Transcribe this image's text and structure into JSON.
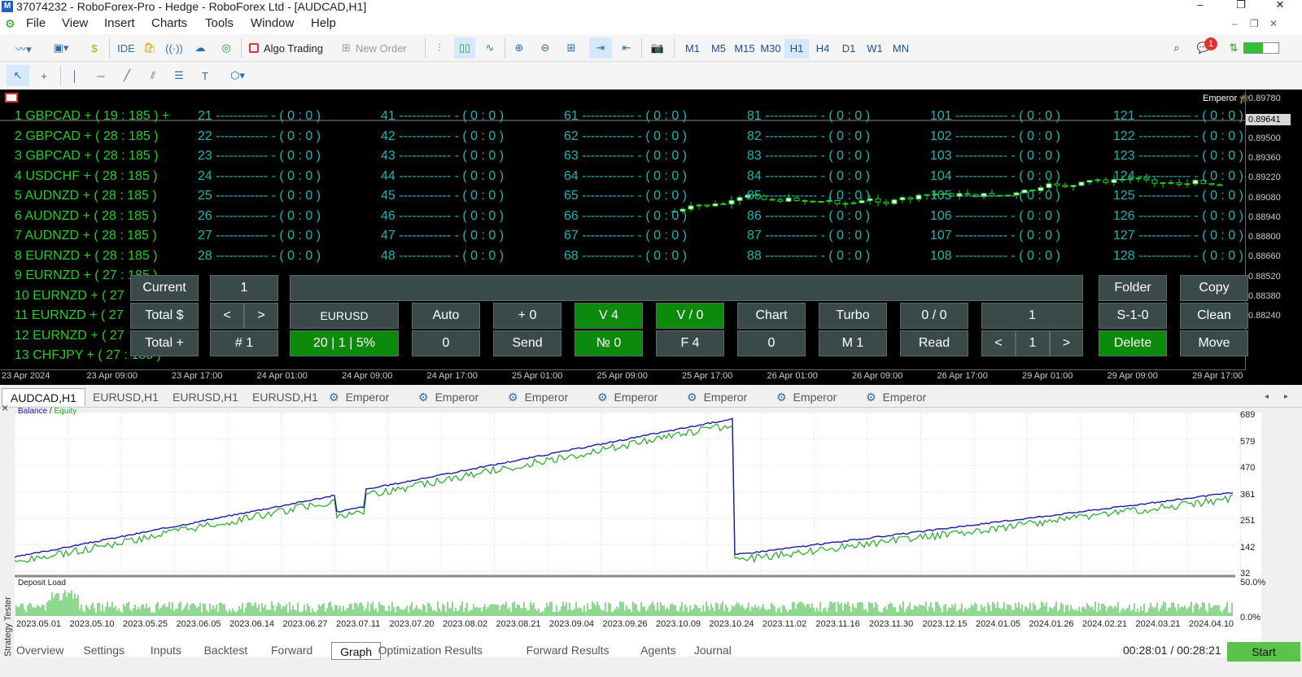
{
  "window": {
    "title": "37074232 - RoboForex-Pro - Hedge - RoboForex Ltd - [AUDCAD,H1]",
    "app_icon": "app-icon",
    "controls": [
      "–",
      "❐",
      "✕"
    ]
  },
  "menu": [
    "File",
    "View",
    "Insert",
    "Charts",
    "Tools",
    "Window",
    "Help"
  ],
  "toolbar": {
    "algo_trading": "Algo Trading",
    "new_order": "New Order",
    "ide": "IDE",
    "timeframes": [
      "M1",
      "M5",
      "M15",
      "M30",
      "H1",
      "H4",
      "D1",
      "W1",
      "MN"
    ],
    "selected_tf": "H1",
    "notifications": "1"
  },
  "chart": {
    "indicator_label": "Emperor",
    "price_current": "0.89641",
    "price_scale": [
      "0.89780",
      "0.89641",
      "0.89500",
      "0.89360",
      "0.89220",
      "0.89080",
      "0.88940",
      "0.88800",
      "0.88660",
      "0.88520",
      "0.88380",
      "0.88240"
    ],
    "time_scale": [
      "23 Apr 2024",
      "23 Apr 09:00",
      "23 Apr 17:00",
      "24 Apr 01:00",
      "24 Apr 09:00",
      "24 Apr 17:00",
      "25 Apr 01:00",
      "25 Apr 09:00",
      "25 Apr 17:00",
      "26 Apr 01:00",
      "26 Apr 09:00",
      "26 Apr 17:00",
      "29 Apr 01:00",
      "29 Apr 09:00",
      "29 Apr 17:00"
    ],
    "pairs": [
      "1 GBPCAD + ( 19 : 185 ) +",
      "2 GBPCAD + ( 28 : 185 )",
      "3 GBPCAD + ( 28 : 185 )",
      "4 USDCHF + ( 28 : 185 )",
      "5 AUDNZD + ( 28 : 185 )",
      "6 AUDNZD + ( 28 : 185 )",
      "7 AUDNZD + ( 28 : 185 )",
      "8 EURNZD + ( 28 : 185 )",
      "9 EURNZD + ( 27 : 185 )",
      "10 EURNZD + ( 27",
      "11 EURNZD + ( 27",
      "12 EURNZD + ( 27",
      "13 CHFJPY + ( 27 : 185 )"
    ],
    "slot_suffix": " ------------ - ( 0 : 0 )",
    "slot_cols": [
      21,
      41,
      61,
      81,
      101,
      121
    ]
  },
  "panel": {
    "current": "Current",
    "current_val": "1",
    "total_usd": "Total $",
    "total_plus": "Total +",
    "prev": "<",
    "next": ">",
    "hash": "# 1",
    "symbol": "EURUSD",
    "risk": "20 | 1 | 5%",
    "auto": "Auto",
    "auto_val": "0",
    "plus0": "+ 0",
    "send": "Send",
    "v4": "V 4",
    "no0": "№ 0",
    "v0": "V / 0",
    "f4": "F 4",
    "chart": "Chart",
    "chart_val": "0",
    "turbo": "Turbo",
    "m1": "M 1",
    "ratio": "0 / 0",
    "read": "Read",
    "page": "1",
    "lt": "<",
    "pg": "1",
    "gt": ">",
    "folder": "Folder",
    "copy": "Copy",
    "s10": "S-1-0",
    "clean": "Clean",
    "delete": "Delete",
    "move": "Move"
  },
  "chart_tabs": [
    "AUDCAD,H1",
    "EURUSD,H1",
    "EURUSD,H1",
    "EURUSD,H1",
    "Emperor",
    "Emperor",
    "Emperor",
    "Emperor",
    "Emperor",
    "Emperor",
    "Emperor"
  ],
  "tester": {
    "side_label": "Strategy Tester",
    "legend_balance": "Balance",
    "legend_sep": " / ",
    "legend_equity": "Equity",
    "yaxis": [
      "689",
      "579",
      "470",
      "361",
      "251",
      "142",
      "32"
    ],
    "deposit_label": "Deposit Load",
    "deposit_axis": [
      "50.0%",
      "0.0%"
    ],
    "xaxis": [
      "2023.05.01",
      "2023.05.10",
      "2023.05.25",
      "2023.06.05",
      "2023.06.14",
      "2023.06.27",
      "2023.07.11",
      "2023.07.20",
      "2023.08.02",
      "2023.08.21",
      "2023.09.04",
      "2023.09.26",
      "2023.10.09",
      "2023.10.24",
      "2023.11.02",
      "2023.11.16",
      "2023.11.30",
      "2023.12.15",
      "2024.01.05",
      "2024.01.26",
      "2024.02.21",
      "2024.03.21",
      "2024.04.10"
    ],
    "tabs": [
      "Overview",
      "Settings",
      "Inputs",
      "Backtest",
      "Forward",
      "Graph",
      "Optimization Results",
      "Forward Results",
      "Agents",
      "Journal"
    ],
    "active_tab": "Graph",
    "time": "00:28:01 / 00:28:21",
    "start": "Start"
  },
  "colors": {
    "chart_bg": "#000000",
    "pair_text": "#1fd21f",
    "slot_text": "#19b6b6",
    "panel_green": "#0b8a0b",
    "balance": "#1a1aa8",
    "equity": "#1fb01f"
  }
}
